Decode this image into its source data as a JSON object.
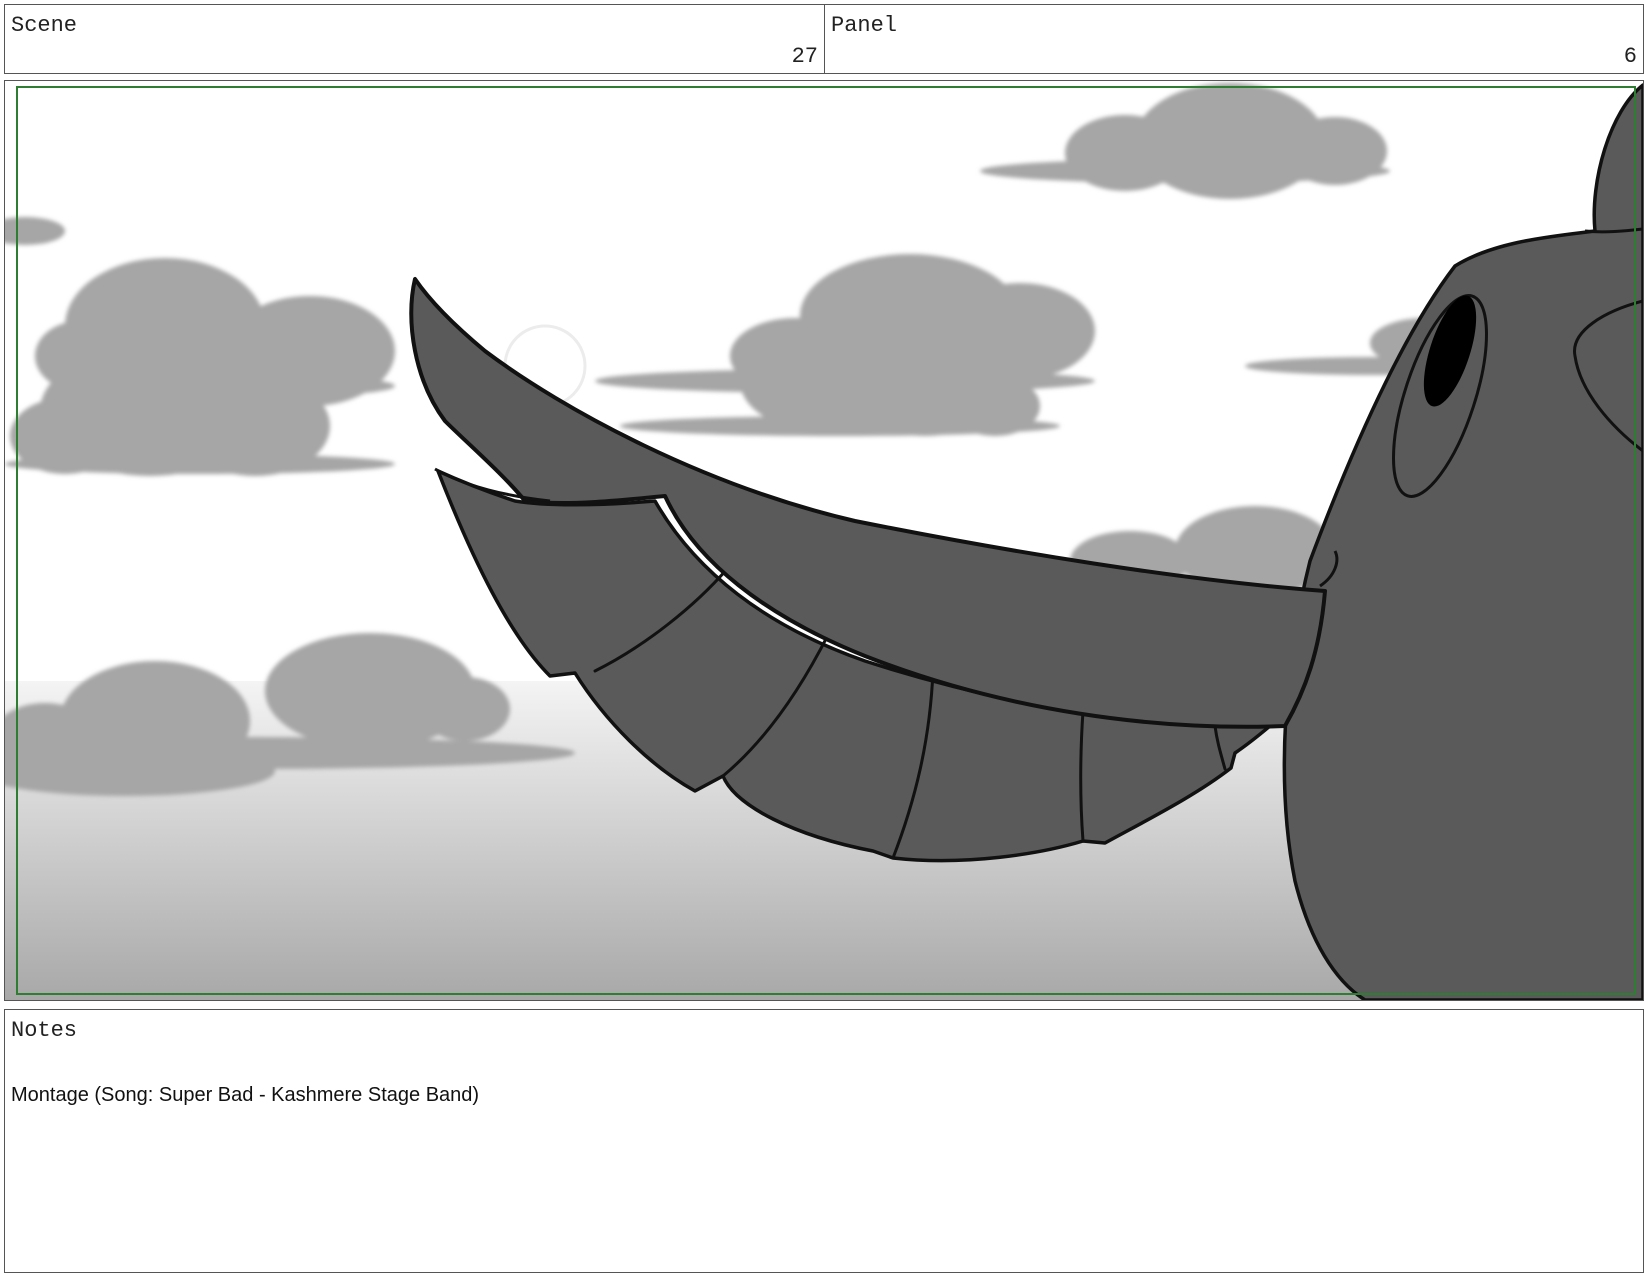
{
  "header": {
    "scene_label": "Scene",
    "scene_number": "27",
    "panel_label": "Panel",
    "panel_number": "6"
  },
  "panel_image": {
    "icon": "storyboard-sketch-bird-wing",
    "colors": {
      "frame_border": "#2e7d32",
      "bird_fill": "#5a5a5a",
      "cloud_fill": "#a6a6a6"
    }
  },
  "notes": {
    "label": "Notes",
    "text": "Montage (Song: Super Bad - Kashmere Stage Band)"
  }
}
